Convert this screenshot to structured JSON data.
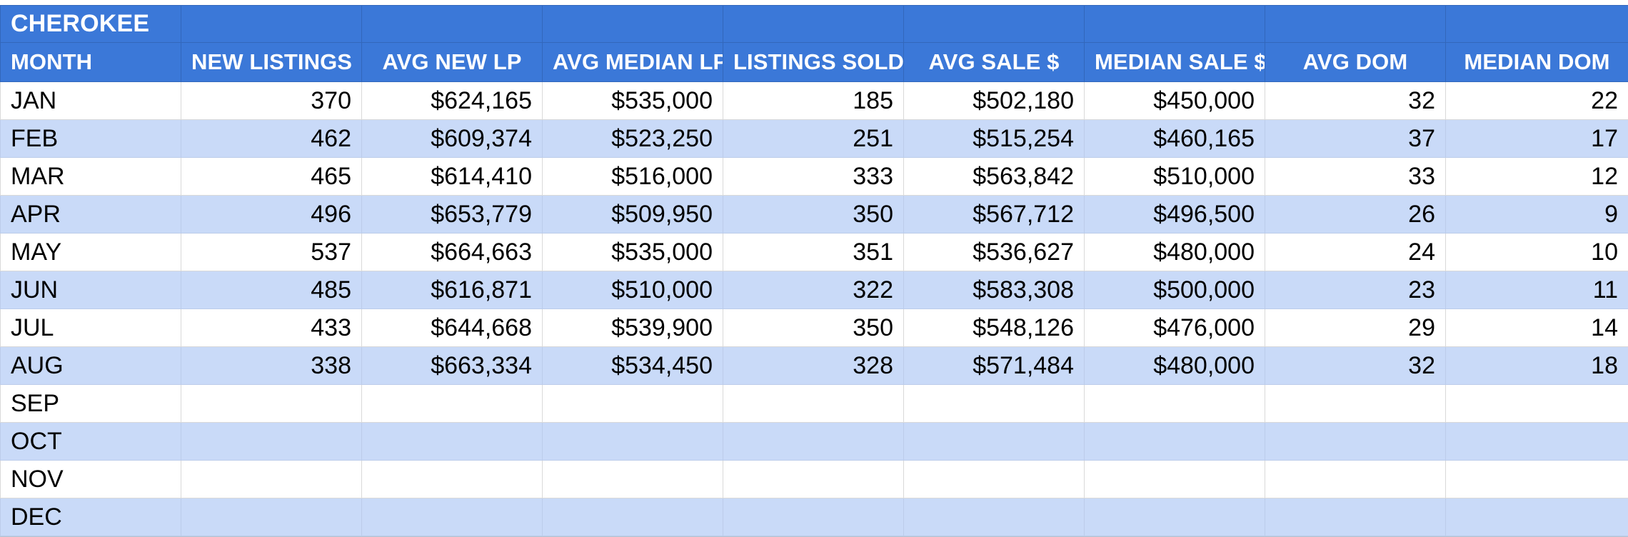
{
  "sheet": {
    "title": "CHEROKEE",
    "accent_color": "#3b78d8",
    "alt_row_color": "#c9daf8",
    "header_text_color": "#ffffff"
  },
  "table": {
    "columns": [
      {
        "key": "month",
        "label": "MONTH",
        "align": "left"
      },
      {
        "key": "new_listings",
        "label": "NEW LISTINGS",
        "align": "right"
      },
      {
        "key": "avg_new_lp",
        "label": "AVG NEW LP",
        "align": "right"
      },
      {
        "key": "avg_median_lp",
        "label": "AVG MEDIAN LP",
        "align": "right"
      },
      {
        "key": "listings_sold",
        "label": "LISTINGS SOLD",
        "align": "right"
      },
      {
        "key": "avg_sale",
        "label": "AVG SALE $",
        "align": "right"
      },
      {
        "key": "median_sale",
        "label": "MEDIAN SALE $",
        "align": "right"
      },
      {
        "key": "avg_dom",
        "label": "AVG DOM",
        "align": "right"
      },
      {
        "key": "median_dom",
        "label": "MEDIAN DOM",
        "align": "right"
      }
    ],
    "rows": [
      {
        "month": "JAN",
        "new_listings": "370",
        "avg_new_lp": "$624,165",
        "avg_median_lp": "$535,000",
        "listings_sold": "185",
        "avg_sale": "$502,180",
        "median_sale": "$450,000",
        "avg_dom": "32",
        "median_dom": "22"
      },
      {
        "month": "FEB",
        "new_listings": "462",
        "avg_new_lp": "$609,374",
        "avg_median_lp": "$523,250",
        "listings_sold": "251",
        "avg_sale": "$515,254",
        "median_sale": "$460,165",
        "avg_dom": "37",
        "median_dom": "17"
      },
      {
        "month": "MAR",
        "new_listings": "465",
        "avg_new_lp": "$614,410",
        "avg_median_lp": "$516,000",
        "listings_sold": "333",
        "avg_sale": "$563,842",
        "median_sale": "$510,000",
        "avg_dom": "33",
        "median_dom": "12"
      },
      {
        "month": "APR",
        "new_listings": "496",
        "avg_new_lp": "$653,779",
        "avg_median_lp": "$509,950",
        "listings_sold": "350",
        "avg_sale": "$567,712",
        "median_sale": "$496,500",
        "avg_dom": "26",
        "median_dom": "9"
      },
      {
        "month": "MAY",
        "new_listings": "537",
        "avg_new_lp": "$664,663",
        "avg_median_lp": "$535,000",
        "listings_sold": "351",
        "avg_sale": "$536,627",
        "median_sale": "$480,000",
        "avg_dom": "24",
        "median_dom": "10"
      },
      {
        "month": "JUN",
        "new_listings": "485",
        "avg_new_lp": "$616,871",
        "avg_median_lp": "$510,000",
        "listings_sold": "322",
        "avg_sale": "$583,308",
        "median_sale": "$500,000",
        "avg_dom": "23",
        "median_dom": "11"
      },
      {
        "month": "JUL",
        "new_listings": "433",
        "avg_new_lp": "$644,668",
        "avg_median_lp": "$539,900",
        "listings_sold": "350",
        "avg_sale": "$548,126",
        "median_sale": "$476,000",
        "avg_dom": "29",
        "median_dom": "14"
      },
      {
        "month": "AUG",
        "new_listings": "338",
        "avg_new_lp": "$663,334",
        "avg_median_lp": "$534,450",
        "listings_sold": "328",
        "avg_sale": "$571,484",
        "median_sale": "$480,000",
        "avg_dom": "32",
        "median_dom": "18"
      },
      {
        "month": "SEP",
        "new_listings": "",
        "avg_new_lp": "",
        "avg_median_lp": "",
        "listings_sold": "",
        "avg_sale": "",
        "median_sale": "",
        "avg_dom": "",
        "median_dom": ""
      },
      {
        "month": "OCT",
        "new_listings": "",
        "avg_new_lp": "",
        "avg_median_lp": "",
        "listings_sold": "",
        "avg_sale": "",
        "median_sale": "",
        "avg_dom": "",
        "median_dom": ""
      },
      {
        "month": "NOV",
        "new_listings": "",
        "avg_new_lp": "",
        "avg_median_lp": "",
        "listings_sold": "",
        "avg_sale": "",
        "median_sale": "",
        "avg_dom": "",
        "median_dom": ""
      },
      {
        "month": "DEC",
        "new_listings": "",
        "avg_new_lp": "",
        "avg_median_lp": "",
        "listings_sold": "",
        "avg_sale": "",
        "median_sale": "",
        "avg_dom": "",
        "median_dom": ""
      }
    ]
  },
  "chart_data": {
    "type": "table",
    "title": "CHEROKEE",
    "columns": [
      "MONTH",
      "NEW LISTINGS",
      "AVG NEW LP",
      "AVG MEDIAN LP",
      "LISTINGS SOLD",
      "AVG SALE $",
      "MEDIAN SALE $",
      "AVG DOM",
      "MEDIAN DOM"
    ],
    "categories": [
      "JAN",
      "FEB",
      "MAR",
      "APR",
      "MAY",
      "JUN",
      "JUL",
      "AUG",
      "SEP",
      "OCT",
      "NOV",
      "DEC"
    ],
    "series": [
      {
        "name": "NEW LISTINGS",
        "values": [
          370,
          462,
          465,
          496,
          537,
          485,
          433,
          338,
          null,
          null,
          null,
          null
        ]
      },
      {
        "name": "AVG NEW LP",
        "values": [
          624165,
          609374,
          614410,
          653779,
          664663,
          616871,
          644668,
          663334,
          null,
          null,
          null,
          null
        ]
      },
      {
        "name": "AVG MEDIAN LP",
        "values": [
          535000,
          523250,
          516000,
          509950,
          535000,
          510000,
          539900,
          534450,
          null,
          null,
          null,
          null
        ]
      },
      {
        "name": "LISTINGS SOLD",
        "values": [
          185,
          251,
          333,
          350,
          351,
          322,
          350,
          328,
          null,
          null,
          null,
          null
        ]
      },
      {
        "name": "AVG SALE $",
        "values": [
          502180,
          515254,
          563842,
          567712,
          536627,
          583308,
          548126,
          571484,
          null,
          null,
          null,
          null
        ]
      },
      {
        "name": "MEDIAN SALE $",
        "values": [
          450000,
          460165,
          510000,
          496500,
          480000,
          500000,
          476000,
          480000,
          null,
          null,
          null,
          null
        ]
      },
      {
        "name": "AVG DOM",
        "values": [
          32,
          37,
          33,
          26,
          24,
          23,
          29,
          32,
          null,
          null,
          null,
          null
        ]
      },
      {
        "name": "MEDIAN DOM",
        "values": [
          22,
          17,
          12,
          9,
          10,
          11,
          14,
          18,
          null,
          null,
          null,
          null
        ]
      }
    ]
  }
}
